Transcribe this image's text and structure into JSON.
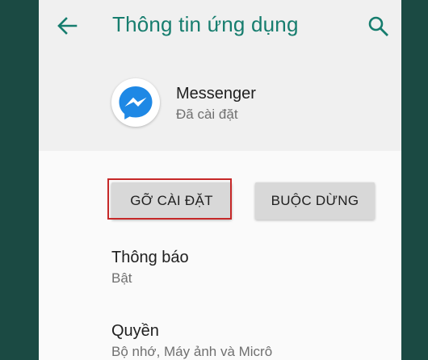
{
  "header": {
    "title": "Thông tin ứng dụng",
    "back_icon": "arrow-back-icon",
    "search_icon": "search-icon",
    "accent_color": "#167d6e"
  },
  "app": {
    "name": "Messenger",
    "status": "Đã cài đặt",
    "icon": "messenger-icon",
    "icon_color": "#1e88e5"
  },
  "actions": {
    "uninstall_label": "GỠ CÀI ĐẶT",
    "force_stop_label": "BUỘC DỪNG",
    "highlight_color": "#c62828"
  },
  "settings": [
    {
      "title": "Thông báo",
      "subtitle": "Bật"
    },
    {
      "title": "Quyền",
      "subtitle": "Bộ nhớ, Máy ảnh và Micrô"
    }
  ]
}
